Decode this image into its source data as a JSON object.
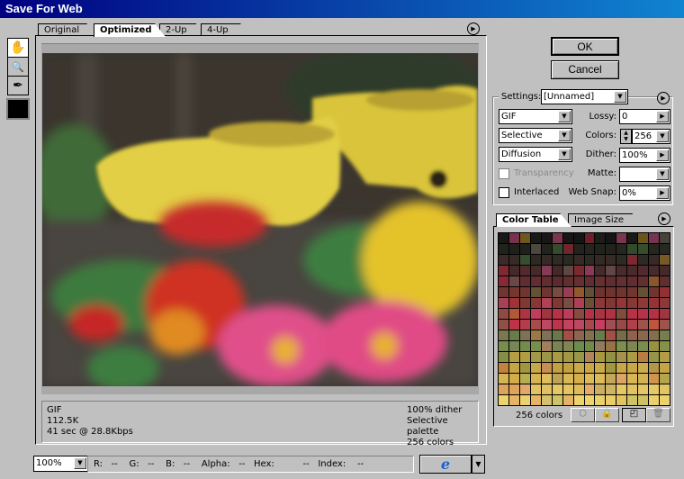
{
  "window": {
    "title": "Save For Web"
  },
  "tabs": [
    {
      "label": "Original"
    },
    {
      "label": "Optimized",
      "active": true
    },
    {
      "label": "2-Up"
    },
    {
      "label": "4-Up"
    }
  ],
  "tools": [
    {
      "icon": "hand-icon",
      "glyph": "✋"
    },
    {
      "icon": "zoom-icon",
      "glyph": "🔍"
    },
    {
      "icon": "eyedropper-icon",
      "glyph": "✒"
    }
  ],
  "eyedropper_color": "#000000",
  "buttons": {
    "ok": "OK",
    "cancel": "Cancel"
  },
  "settings": {
    "label": "Settings:",
    "preset": "[Unnamed]",
    "format": "GIF",
    "palette": "Selective",
    "dither_method": "Diffusion",
    "lossy_label": "Lossy:",
    "lossy": "0",
    "colors_label": "Colors:",
    "colors": "256",
    "dither_label": "Dither:",
    "dither": "100%",
    "matte_label": "Matte:",
    "matte": "",
    "websnap_label": "Web Snap:",
    "websnap": "0%",
    "transparency_label": "Transparency",
    "transparency_checked": false,
    "transparency_enabled": false,
    "interlaced_label": "Interlaced",
    "interlaced_checked": false
  },
  "panel_tabs": [
    {
      "label": "Color Table",
      "active": true
    },
    {
      "label": "Image Size"
    }
  ],
  "color_table": {
    "count_label": "256 colors",
    "stops": [
      "#141414",
      "#2a2a22",
      "#5a2a30",
      "#7a3a30",
      "#c0304a",
      "#6a8a50",
      "#c0a040",
      "#e0c060",
      "#f0d870"
    ]
  },
  "info": {
    "left": [
      "GIF",
      "112.5K",
      "41 sec @ 28.8Kbps"
    ],
    "right": [
      "100% dither",
      "Selective palette",
      "256 colors"
    ]
  },
  "statusbar": {
    "zoom": "100%",
    "r_label": "R:",
    "r": "--",
    "g_label": "G:",
    "g": "--",
    "b_label": "B:",
    "b": "--",
    "alpha_label": "Alpha:",
    "alpha": "--",
    "hex_label": "Hex:",
    "hex": "--",
    "index_label": "Index:",
    "index": "--"
  },
  "browser_icon": "internet-explorer-icon"
}
